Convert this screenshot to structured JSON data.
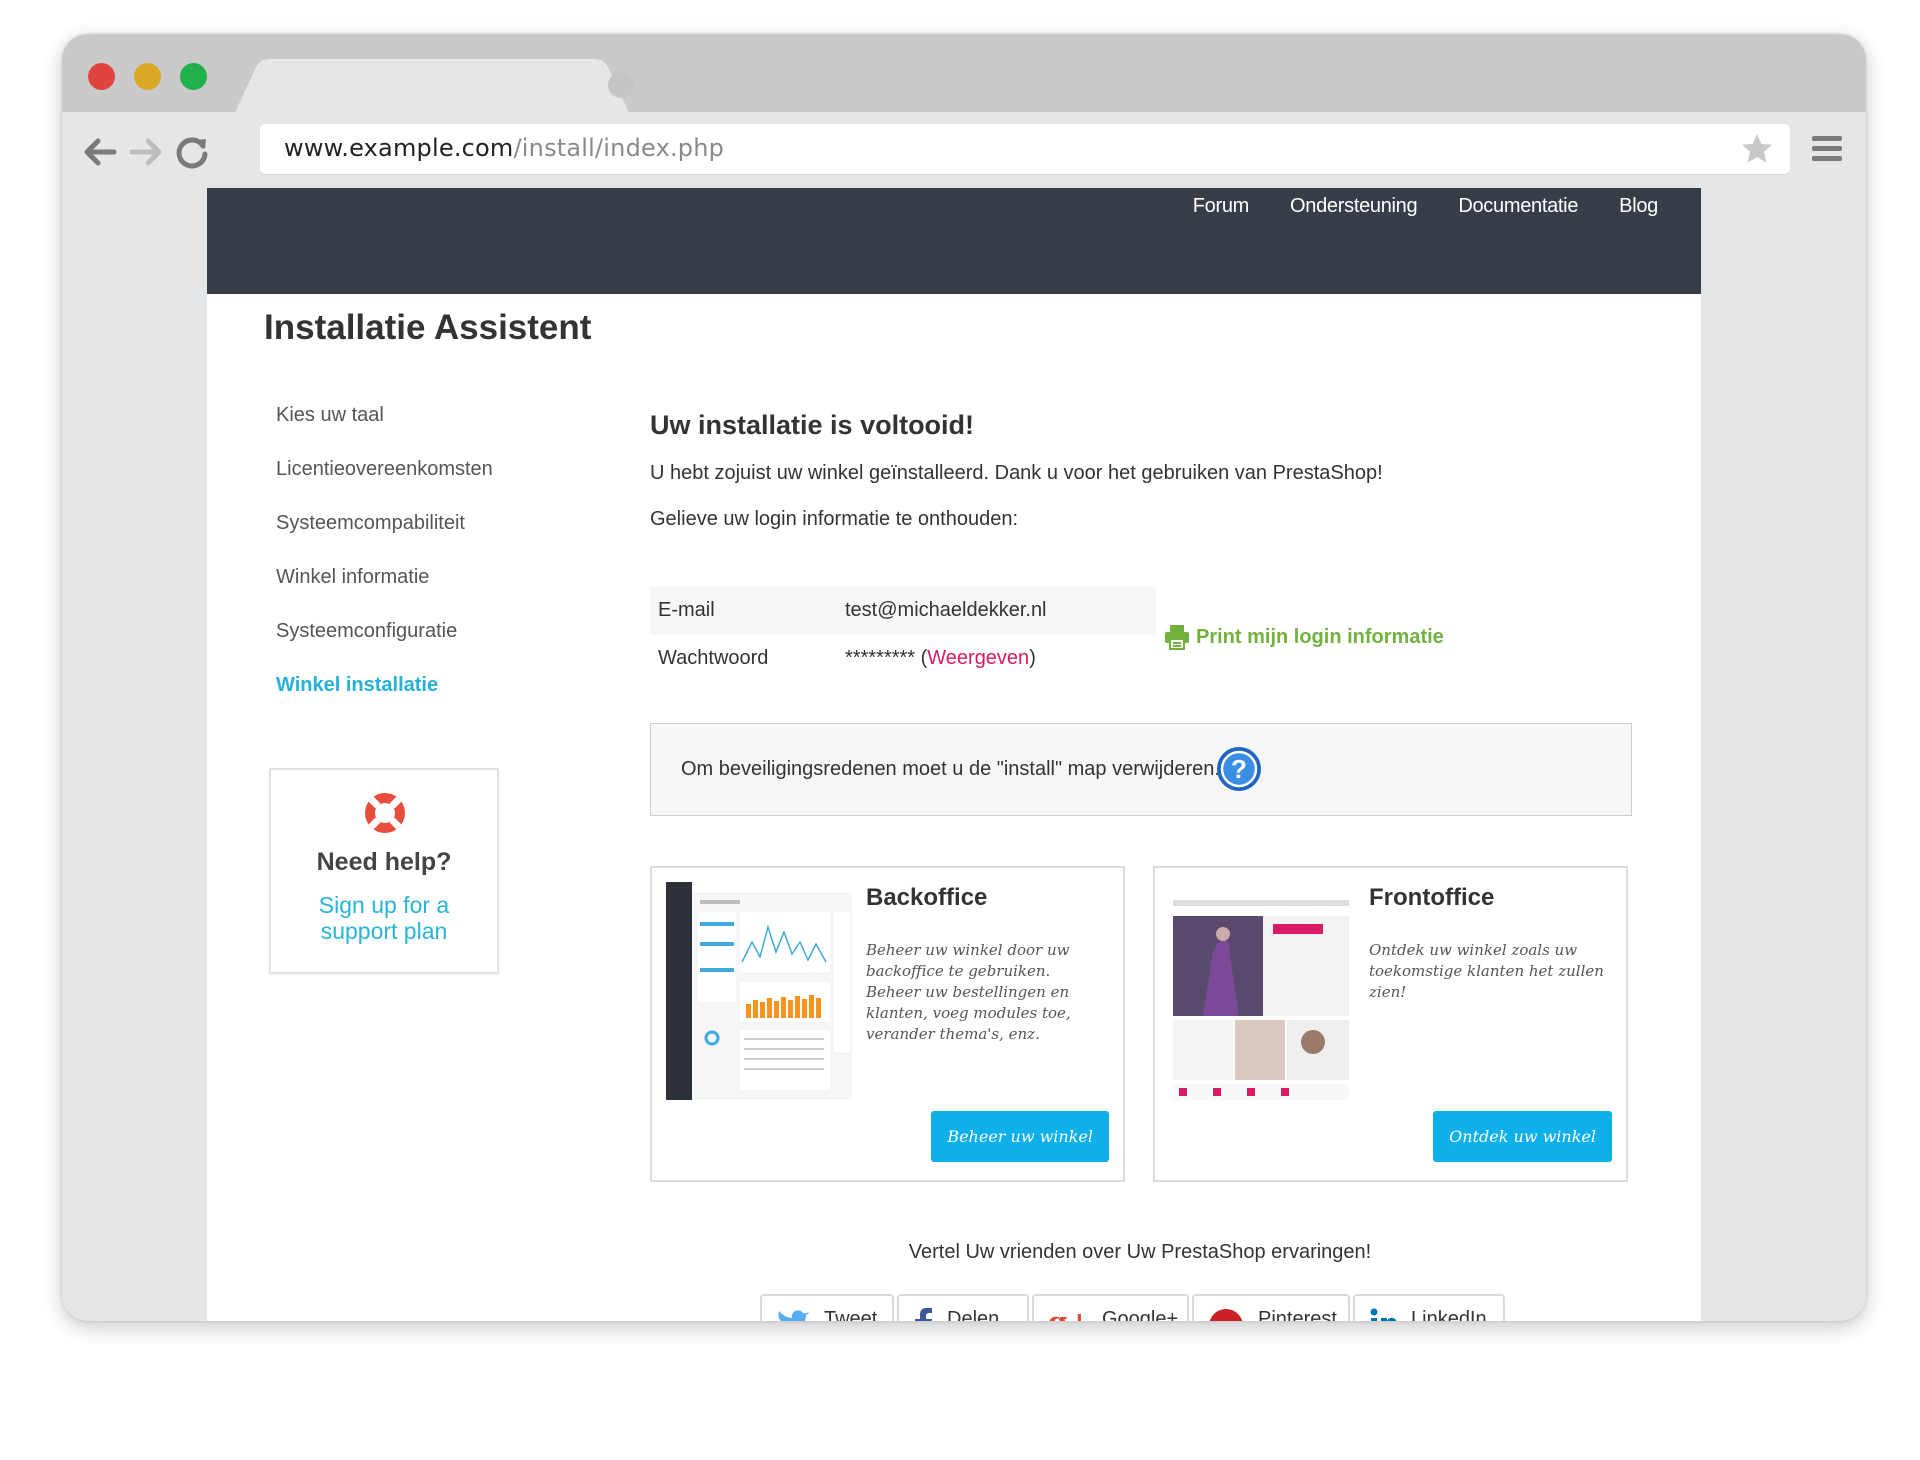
{
  "browser": {
    "url_host": "www.example.com",
    "url_path": "/install/index.php"
  },
  "topnav": {
    "links": [
      "Forum",
      "Ondersteuning",
      "Documentatie",
      "Blog"
    ]
  },
  "page_title": "Installatie Assistent",
  "steps": [
    {
      "label": "Kies uw taal",
      "active": false
    },
    {
      "label": "Licentieovereenkomsten",
      "active": false
    },
    {
      "label": "Systeemcompabiliteit",
      "active": false
    },
    {
      "label": "Winkel informatie",
      "active": false
    },
    {
      "label": "Systeemconfiguratie",
      "active": false
    },
    {
      "label": "Winkel installatie",
      "active": true
    }
  ],
  "help": {
    "title": "Need help?",
    "link_line1": "Sign up for a",
    "link_line2": "support plan"
  },
  "main": {
    "heading": "Uw installatie is voltooid!",
    "intro": "U hebt zojuist uw winkel geïnstalleerd. Dank u voor het gebruiken van PrestaShop!",
    "remember": "Gelieve uw login informatie te onthouden:",
    "login": {
      "email_label": "E-mail",
      "email_value": "test@michaeldekker.nl",
      "password_label": "Wachtwoord",
      "password_value": "********* (",
      "show_link": "Weergeven",
      "close_paren": ")"
    },
    "print_label": "Print mijn login informatie",
    "security_warning": "Om beveiligingsredenen moet u de \"install\" map verwijderen."
  },
  "cards": {
    "backoffice": {
      "title": "Backoffice",
      "description": "Beheer uw winkel door uw backoffice te gebruiken. Beheer uw bestellingen en klanten, voeg modules toe, verander thema's, enz.",
      "button": "Beheer uw winkel"
    },
    "frontoffice": {
      "title": "Frontoffice",
      "description": "Ontdek uw winkel zoals uw toekomstige klanten het zullen zien!",
      "button": "Ontdek uw winkel"
    }
  },
  "share": {
    "text": "Vertel Uw vrienden over Uw PrestaShop ervaringen!",
    "buttons": [
      "Tweet",
      "Delen",
      "Google+",
      "Pinterest",
      "LinkedIn"
    ]
  },
  "colors": {
    "nav_bg": "#383e48",
    "active_step": "#24b0d7",
    "print_green": "#72b13e",
    "link_pink": "#d91a67",
    "button_blue": "#0eb0e9"
  },
  "icons": [
    "back-arrow-icon",
    "forward-arrow-icon",
    "reload-icon",
    "bookmark-star-icon",
    "menu-icon",
    "lifebuoy-icon",
    "printer-icon",
    "help-question-icon",
    "twitter-icon",
    "facebook-icon",
    "google-plus-icon",
    "pinterest-icon",
    "linkedin-icon"
  ]
}
